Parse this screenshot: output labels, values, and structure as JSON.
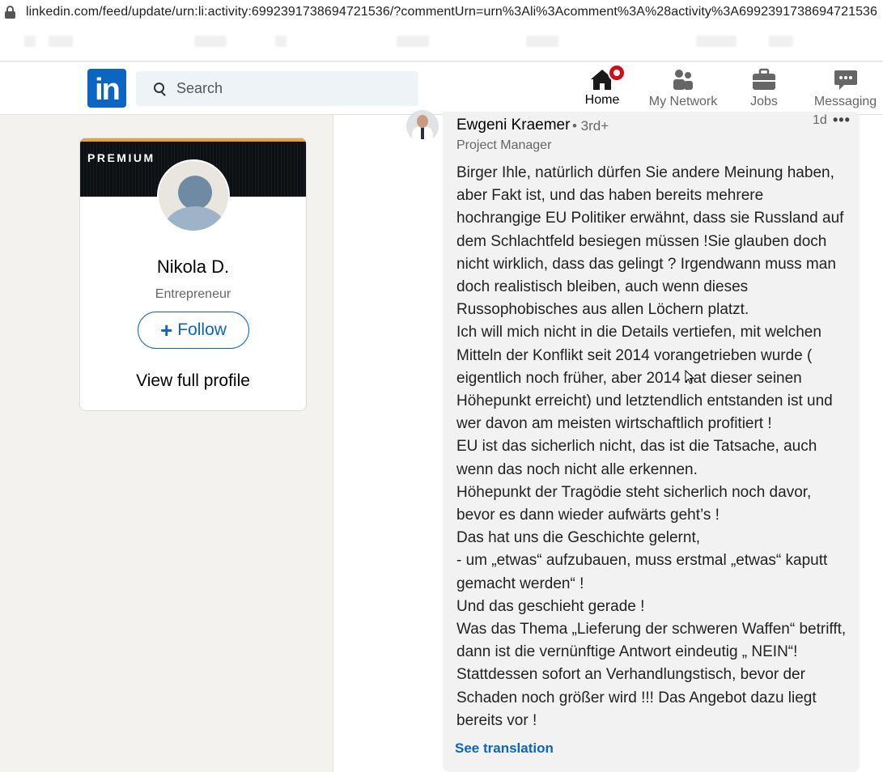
{
  "browser": {
    "url": "linkedin.com/feed/update/urn:li:activity:6992391738694721536/?commentUrn=urn%3Ali%3Acomment%3A%28activity%3A6992391738694721536"
  },
  "nav": {
    "search_placeholder": "Search",
    "logo_text": "in",
    "items": [
      {
        "label": "Home",
        "icon": "home-icon",
        "active": true
      },
      {
        "label": "My Network",
        "icon": "network-icon"
      },
      {
        "label": "Jobs",
        "icon": "briefcase-icon"
      },
      {
        "label": "Messaging",
        "icon": "message-icon"
      }
    ]
  },
  "profile_card": {
    "badge": "PREMIUM",
    "name": "Nikola D.",
    "title": "Entrepreneur",
    "follow_label": "Follow",
    "view_profile_label": "View full profile"
  },
  "comment": {
    "author": "Ewgeni Kraemer",
    "degree": "• 3rd+",
    "headline": "Project Manager",
    "time": "1d",
    "more": "•••",
    "text": "Birger Ihle, natürlich dürfen Sie andere Meinung haben, aber Fakt ist, und das haben bereits mehrere hochrangige EU Politiker erwähnt, dass sie Russland auf dem Schlachtfeld besiegen müssen !Sie glauben doch nicht wirklich, dass das gelingt ? Irgendwann muss man doch realistisch bleiben, auch wenn dieses Russophobisches aus allen Löchern platzt.\nIch will mich nicht in die Details vertiefen, mit welchen Mitteln der Konflikt seit 2014 vorangetrieben wurde ( eigentlich noch früher, aber 2014 hat dieser seinen Höhepunkt erreicht) und letztendlich entstanden ist und wer davon am meisten wirtschaftlich profitiert !\nEU ist das sicherlich nicht, das ist die Tatsache, auch wenn das noch nicht alle erkennen.\nHöhepunkt der Tragödie steht sicherlich noch davor, bevor es dann wieder aufwärts geht’s !\nDas hat uns die Geschichte gelernt,\n- um „etwas“ aufzubauen, muss erstmal „etwas“ kaputt gemacht werden“ !\nUnd das geschieht gerade !\nWas das Thema „Lieferung der schweren Waffen“ betrifft, dann ist die vernünftige Antwort eindeutig „ NEIN“! Stattdessen sofort an Verhandlungstisch, bevor der Schaden noch größer wird !!! Das Angebot dazu liegt bereits vor !",
    "translate_label": "See translation"
  },
  "colors": {
    "brand": "#0a66c2",
    "notification": "#cc1016",
    "premium_accent": "#e7a33e"
  }
}
